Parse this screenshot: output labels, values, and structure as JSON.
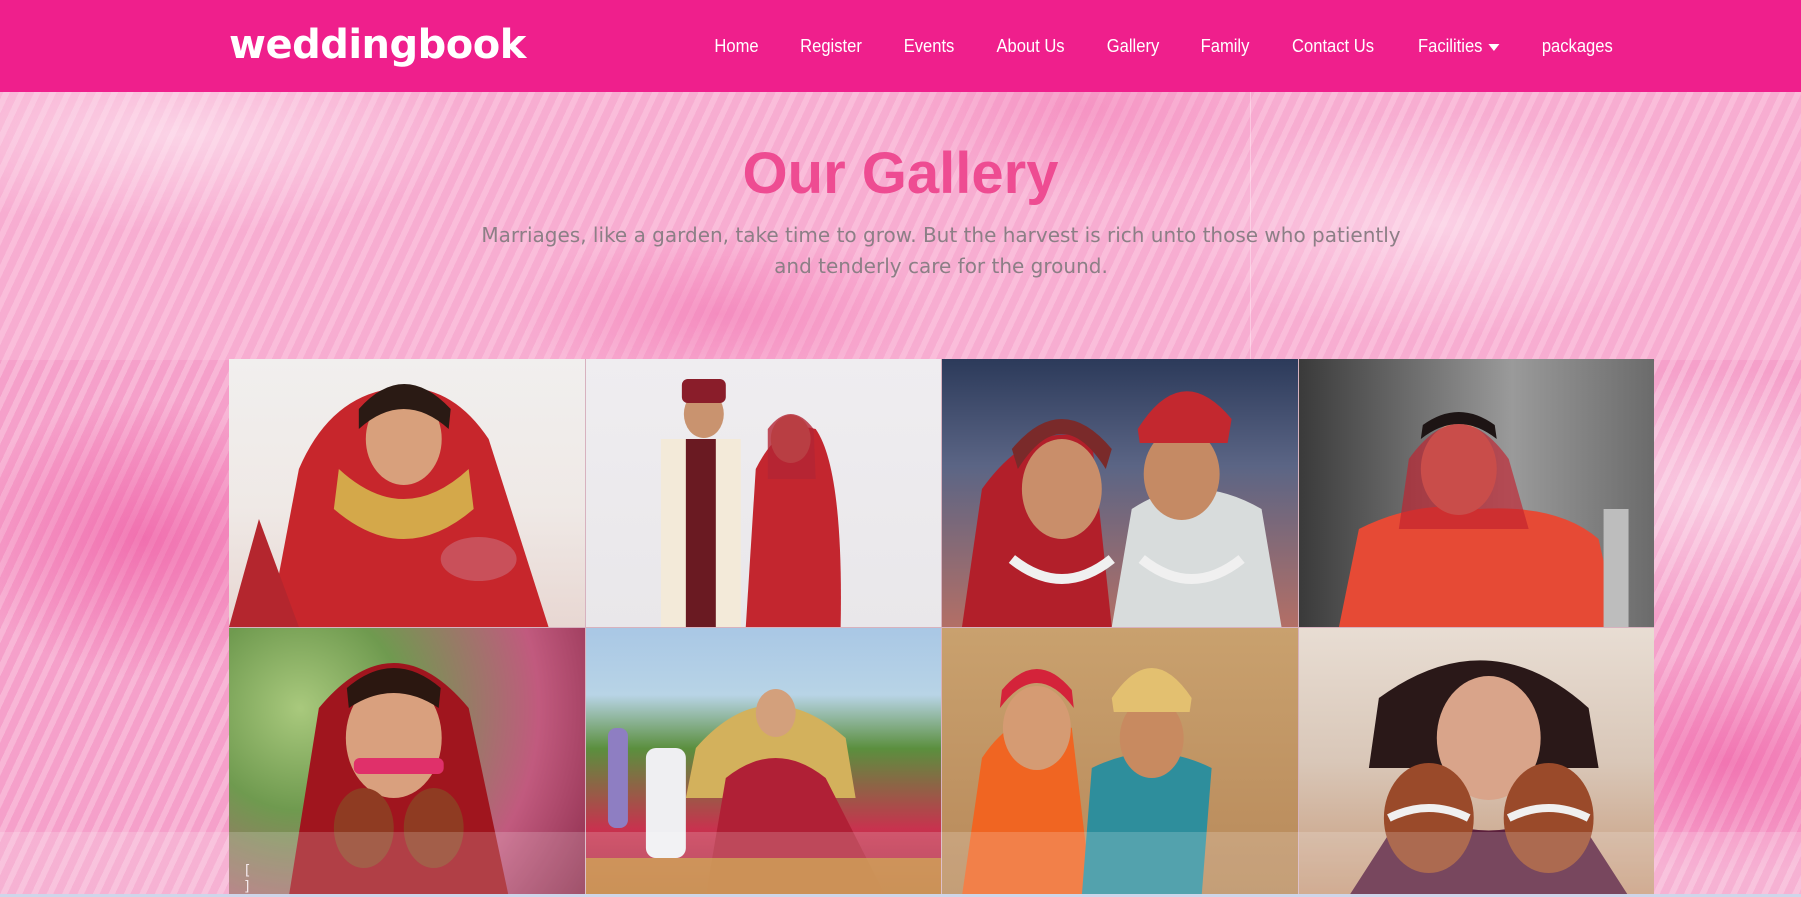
{
  "brand": {
    "name": "weddingbook"
  },
  "nav": {
    "items": [
      {
        "label": "Home"
      },
      {
        "label": "Register"
      },
      {
        "label": "Events"
      },
      {
        "label": "About Us"
      },
      {
        "label": "Gallery"
      },
      {
        "label": "Family"
      },
      {
        "label": "Contact Us"
      },
      {
        "label": "Facilities",
        "icon": "caret-down-icon"
      },
      {
        "label": "packages"
      }
    ]
  },
  "hero": {
    "title": "Our Gallery",
    "subtitle": "Marriages, like a garden, take time to grow. But the harvest is rich unto those who patiently and tenderly care for the ground."
  },
  "colors": {
    "navbar": "#ef1f8c",
    "title": "#ee4c92",
    "subtitle": "#8c7f86",
    "background": "#f6a6cd"
  },
  "gallery": {
    "photos": [
      {
        "subject": "bride-with-mask"
      },
      {
        "subject": "couple-standing"
      },
      {
        "subject": "couple-smiling-garlands"
      },
      {
        "subject": "bride-seated-grey-background"
      },
      {
        "subject": "bride-with-lipstick"
      },
      {
        "subject": "bride-on-throne-outdoor"
      },
      {
        "subject": "couple-turban"
      },
      {
        "subject": "bride-hands-under-chin"
      }
    ],
    "expand_icon": "[ ]"
  }
}
